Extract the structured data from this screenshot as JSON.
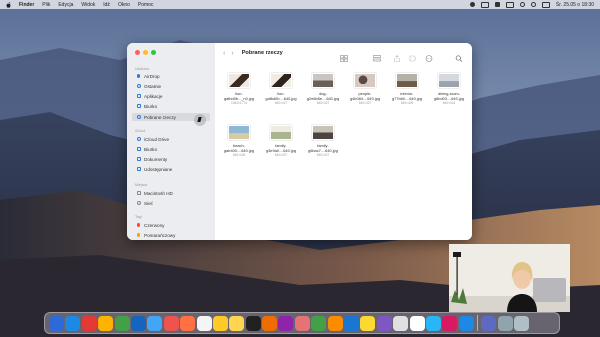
{
  "menubar": {
    "app_name": "Finder",
    "menus": [
      "Plik",
      "Edycja",
      "Widok",
      "Idź",
      "Okno",
      "Pomoc"
    ],
    "clock": "Śr. 25.05 o 18:30"
  },
  "finder": {
    "title": "Pobrane rzeczy",
    "sidebar": {
      "sections": [
        {
          "header": "Ulubione",
          "items": [
            {
              "label": "AirDrop",
              "icon": "airdrop-icon"
            },
            {
              "label": "Ostatnie",
              "icon": "clock-icon"
            },
            {
              "label": "Aplikacje",
              "icon": "applications-icon"
            },
            {
              "label": "Biurko",
              "icon": "desktop-icon"
            },
            {
              "label": "Pobrane rzeczy",
              "icon": "downloads-icon",
              "selected": true
            }
          ]
        },
        {
          "header": "iCloud",
          "items": [
            {
              "label": "iCloud Drive",
              "icon": "cloud-icon"
            },
            {
              "label": "Biurko",
              "icon": "desktop-icon"
            },
            {
              "label": "Dokumenty",
              "icon": "document-icon"
            },
            {
              "label": "Udostępniane",
              "icon": "shared-folder-icon"
            }
          ]
        },
        {
          "header": "Miejsca",
          "items": [
            {
              "label": "Macintosh HD",
              "icon": "disk-icon"
            },
            {
              "label": "Sieć",
              "icon": "network-icon"
            }
          ]
        },
        {
          "header": "Tagi",
          "items": [
            {
              "label": "Czerwony",
              "icon": "red-tag-icon"
            },
            {
              "label": "Pomarańczowy",
              "icon": "orange-tag-icon"
            }
          ]
        }
      ]
    },
    "files": [
      {
        "name1": "lion-",
        "name2": "gafbd0b..._n0.jpg",
        "meta": "1063×1774",
        "thumb": [
          "#ede9e2",
          "#3a2a1f"
        ]
      },
      {
        "name1": "lion-",
        "name2": "gafbd0b....640.jpg",
        "meta": "640×427",
        "thumb": [
          "#f0ece4",
          "#2e231c"
        ]
      },
      {
        "name1": "dog-",
        "name2": "g2e6b6e....640.jpg",
        "meta": "640×427",
        "thumb": [
          "#c9c6c2",
          "#6b5f55"
        ]
      },
      {
        "name1": "people-",
        "name2": "g4b084....640.jpg",
        "meta": "640×427",
        "thumb": [
          "#d8c9c0",
          "#5a4b48"
        ]
      },
      {
        "name1": "interior-",
        "name2": "g77b60....640.jpg",
        "meta": "640×426",
        "thumb": [
          "#b7b0a8",
          "#6e5a48"
        ]
      },
      {
        "name1": "dining-room-",
        "name2": "g6bd03....640.jpg",
        "meta": "640×424",
        "thumb": [
          "#d5d9de",
          "#9aa3ad"
        ]
      },
      {
        "name1": "beach-",
        "name2": "gab400....640.jpg",
        "meta": "640×426",
        "thumb": [
          "#8fb8d6",
          "#d9c9a4"
        ]
      },
      {
        "name1": "family-",
        "name2": "g3e9a0....640.jpg",
        "meta": "640×427",
        "thumb": [
          "#a9b58e",
          "#f0ebe2"
        ]
      },
      {
        "name1": "family-",
        "name2": "g6bac7....640.jpg",
        "meta": "640×427",
        "thumb": [
          "#c8c2b9",
          "#4c4440"
        ]
      }
    ]
  },
  "dock_colors": [
    "#2d6ad8",
    "#1e88e5",
    "#e53935",
    "#ffb300",
    "#43a047",
    "#1565c0",
    "#42a5f5",
    "#ef5350",
    "#ff7043",
    "#f5f5f5",
    "#ffca28",
    "#ffd54f",
    "#212121",
    "#ef6c00",
    "#8e24aa",
    "#e57373",
    "#43a047",
    "#fb8c00",
    "#1976d2",
    "#fdd835",
    "#7e57c2",
    "#e0e0e0",
    "#ffffff",
    "#29b6f6",
    "#d81b60",
    "#1e88e5",
    "#5c6bc0",
    "#90a4ae",
    "#b0bec5"
  ],
  "accent": "#2e7bd6"
}
